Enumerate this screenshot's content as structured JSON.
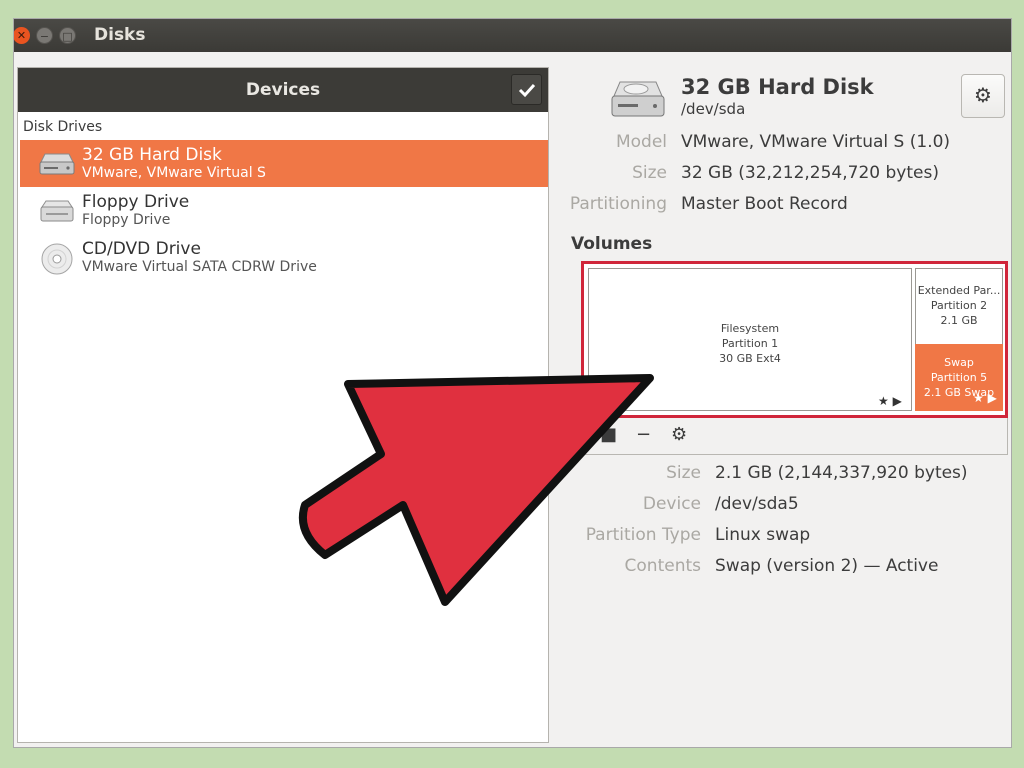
{
  "window": {
    "title": "Disks"
  },
  "devices_panel": {
    "header": "Devices",
    "section_label": "Disk Drives",
    "items": [
      {
        "name": "32 GB Hard Disk",
        "subtitle": "VMware, VMware Virtual S",
        "icon": "hard-disk-icon",
        "selected": true
      },
      {
        "name": "Floppy Drive",
        "subtitle": "Floppy Drive",
        "icon": "floppy-drive-icon",
        "selected": false
      },
      {
        "name": "CD/DVD Drive",
        "subtitle": "VMware Virtual SATA CDRW Drive",
        "icon": "optical-drive-icon",
        "selected": false
      }
    ]
  },
  "disk": {
    "name": "32 GB Hard Disk",
    "device": "/dev/sda",
    "properties": [
      {
        "key": "Model",
        "value": "VMware, VMware Virtual S (1.0)"
      },
      {
        "key": "Size",
        "value": "32 GB (32,212,254,720 bytes)"
      },
      {
        "key": "Partitioning",
        "value": "Master Boot Record"
      }
    ]
  },
  "volumes": {
    "label": "Volumes",
    "partitions": [
      {
        "lines": [
          "Filesystem",
          "Partition 1",
          "30 GB Ext4"
        ]
      },
      {
        "lines": [
          "Extended Par...",
          "Partition 2",
          "2.1 GB"
        ]
      },
      {
        "lines": [
          "Swap",
          "Partition 5",
          "2.1 GB Swap"
        ]
      }
    ],
    "toolbar": [
      "stop-icon",
      "minus-icon",
      "gears-icon"
    ]
  },
  "selected_volume": {
    "properties": [
      {
        "key": "Size",
        "value": "2.1 GB (2,144,337,920 bytes)"
      },
      {
        "key": "Device",
        "value": "/dev/sda5"
      },
      {
        "key": "Partition Type",
        "value": "Linux swap"
      },
      {
        "key": "Contents",
        "value": "Swap (version 2) — Active"
      }
    ]
  },
  "colors": {
    "accent": "#f07746",
    "selection_frame": "#d0263a",
    "arrow": "#e0303f",
    "titlebar": "#3c3b37"
  }
}
